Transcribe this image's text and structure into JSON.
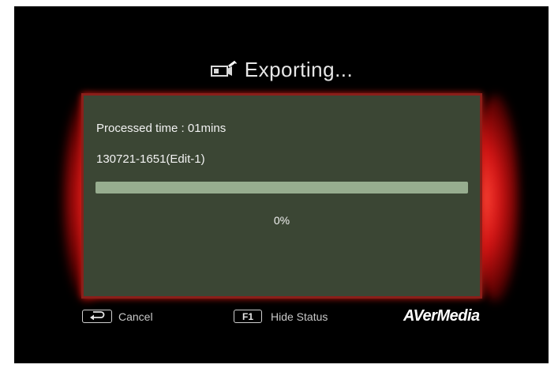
{
  "dialog": {
    "title": "Exporting...",
    "title_icon": "camcorder-edit-icon",
    "processed_time": "Processed time : 01mins",
    "file_name": "130721-1651(Edit-1)",
    "progress_fraction": 0.0,
    "progress_percent_text": "0%"
  },
  "footer": {
    "cancel_key_icon": "back-arrow-icon",
    "cancel_label": "Cancel",
    "hide_key": "F1",
    "hide_label": "Hide Status",
    "brand": "AVerMedia"
  },
  "colors": {
    "panel_bg": "#3b4634",
    "panel_border": "#8a1f1a",
    "glow": "#d11414",
    "progress_track": "#97ad8f",
    "text": "#f2f2f2"
  }
}
